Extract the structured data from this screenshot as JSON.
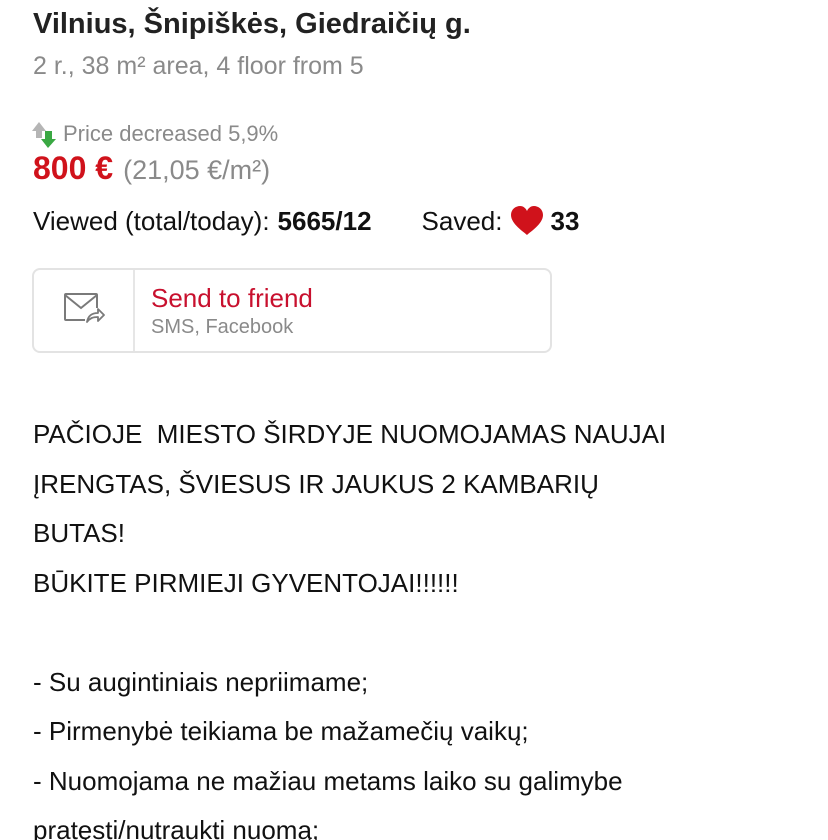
{
  "listing": {
    "title": "Vilnius, Šnipiškės, Giedraičių g.",
    "subtitle": "2 r., 38 m² area, 4 floor from 5",
    "price_change": "Price decreased 5,9%",
    "price": "800 €",
    "price_per_sqm": "(21,05 €/m²)",
    "viewed_label": "Viewed (total/today):",
    "viewed_value": "5665/12",
    "saved_label": "Saved:",
    "saved_value": "33"
  },
  "share": {
    "title": "Send to friend",
    "subtitle": "SMS, Facebook"
  },
  "description": {
    "lines": [
      "PAČIOJE  MIESTO ŠIRDYJE NUOMOJAMAS NAUJAI",
      "ĮRENGTAS, ŠVIESUS IR JAUKUS 2 KAMBARIŲ",
      "BUTAS!",
      "BŪKITE PIRMIEJI GYVENTOJAI!!!!!!",
      "",
      "- Su augintiniais nepriimame;",
      "- Pirmenybė teikiama be mažamečių vaikų;",
      "- Nuomojama ne mažiau metams laiko su galimybe",
      "pratęsti/nutraukti nuomą;"
    ]
  },
  "colors": {
    "price": "#d0121b",
    "share_title": "#c8102e",
    "heart": "#d0121b",
    "muted_text": "#8a8a8a",
    "arrow_down": "#3aa843"
  },
  "icons": {
    "price_change": "price-change-arrows-icon",
    "saved": "heart-icon",
    "share": "envelope-share-icon"
  }
}
